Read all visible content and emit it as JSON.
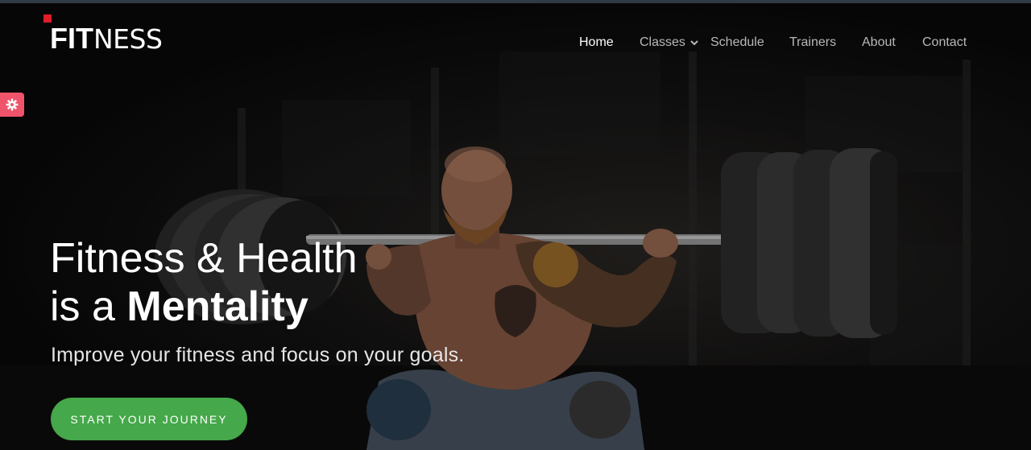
{
  "brand": {
    "logo_bold": "FIT",
    "logo_light": "NESS",
    "accent_color": "#e11d2a"
  },
  "nav": {
    "items": [
      {
        "label": "Home",
        "active": true
      },
      {
        "label": "Classes",
        "has_dropdown": true
      },
      {
        "label": "Schedule"
      },
      {
        "label": "Trainers"
      },
      {
        "label": "About"
      },
      {
        "label": "Contact"
      }
    ]
  },
  "settings": {
    "icon": "gear-icon",
    "color": "#f0546a"
  },
  "hero": {
    "line1": "Fitness & Health",
    "line2_prefix": "is a ",
    "line2_strong": "Mentality",
    "subtitle": "Improve your fitness and focus on your goals.",
    "cta_label": "START YOUR JOURNEY",
    "cta_color": "#45a84a",
    "background_image": "man-squatting-barbell-photo"
  }
}
